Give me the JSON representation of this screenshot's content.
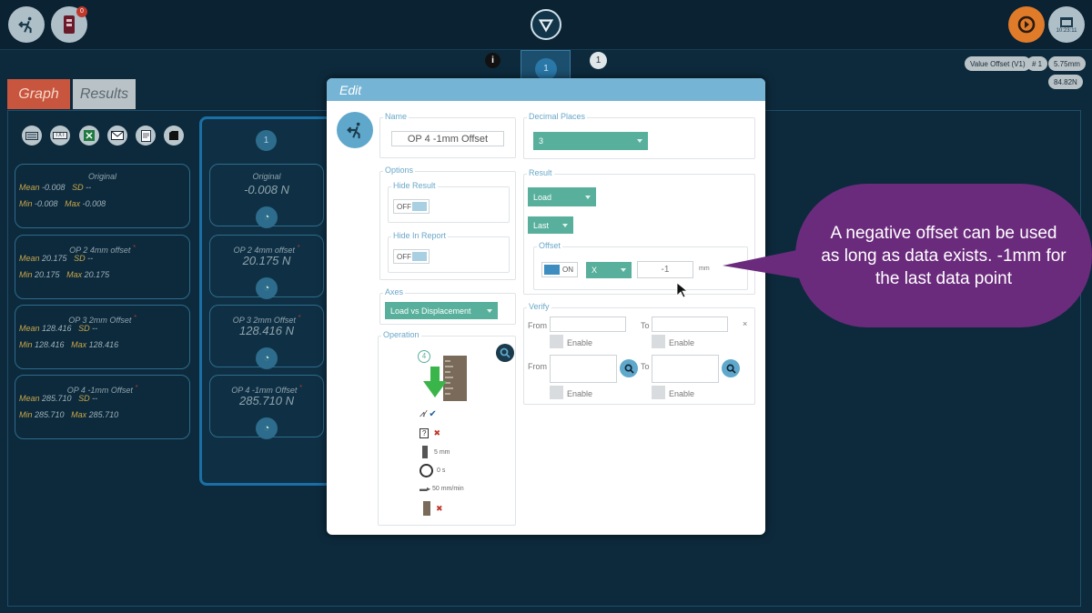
{
  "header": {
    "notification_count": "0",
    "clock_time": "10:23:11"
  },
  "status_pills": {
    "value_offset": "Value Offset (V1)",
    "index": "# 1",
    "displacement": "5.75mm",
    "force": "84.82N"
  },
  "top_stage": {
    "left_badge": "i",
    "center_number": "1",
    "right_number": "1"
  },
  "tabs": {
    "graph": "Graph",
    "results": "Results"
  },
  "toolbar": {
    "export_txt": "TXT"
  },
  "column_number": "1",
  "summary_cards": [
    {
      "title": "Original",
      "mean": "-0.008",
      "sd": "--",
      "min": "-0.008",
      "max": "-0.008"
    },
    {
      "title": "OP 2 4mm offset",
      "mark": "*",
      "mean": "20.175",
      "sd": "--",
      "min": "20.175",
      "max": "20.175"
    },
    {
      "title": "OP 3 2mm Offset",
      "mark": "*",
      "mean": "128.416",
      "sd": "--",
      "min": "128.416",
      "max": "128.416"
    },
    {
      "title": "OP 4 -1mm Offset",
      "mark": "*",
      "mean": "285.710",
      "sd": "--",
      "min": "285.710",
      "max": "285.710"
    }
  ],
  "summary_labels": {
    "mean": "Mean",
    "sd": "SD",
    "min": "Min",
    "max": "Max"
  },
  "value_cards": [
    {
      "title": "Original",
      "value": "-0.008 N"
    },
    {
      "title": "OP 2 4mm offset",
      "mark": "*",
      "value": "20.175 N"
    },
    {
      "title": "OP 3 2mm Offset",
      "mark": "*",
      "value": "128.416 N"
    },
    {
      "title": "OP 4 -1mm Offset",
      "mark": "*",
      "value": "285.710 N"
    }
  ],
  "modal": {
    "title": "Edit",
    "name_legend": "Name",
    "name_value": "OP 4 -1mm Offset",
    "decimal_legend": "Decimal Places",
    "decimal_value": "3",
    "options_legend": "Options",
    "hide_result_legend": "Hide Result",
    "hide_result_state": "OFF",
    "hide_report_legend": "Hide In Report",
    "hide_report_state": "OFF",
    "axes_legend": "Axes",
    "axes_value": "Load vs Displacement",
    "operation_legend": "Operation",
    "op_step": "4",
    "op_rows": [
      {
        "icon": "signal-icon",
        "value": ""
      },
      {
        "icon": "question-icon",
        "value": ""
      },
      {
        "icon": "distance-icon",
        "value": "5 mm"
      },
      {
        "icon": "timer-icon",
        "value": "0 s"
      },
      {
        "icon": "speed-icon",
        "value": "50 mm/min"
      },
      {
        "icon": "specimen-icon",
        "value": ""
      }
    ],
    "result_legend": "Result",
    "result_type": "Load",
    "result_position": "Last",
    "offset_legend": "Offset",
    "offset_state": "ON",
    "offset_axis": "X",
    "offset_value": "-1",
    "offset_unit": "mm",
    "verify_legend": "Verify",
    "from_label": "From",
    "to_label": "To",
    "enable_label": "Enable"
  },
  "callout": {
    "text": "A negative offset can be used as long as data exists. -1mm for the last data point"
  },
  "colors": {
    "background": "#0d2a3c",
    "accent": "#75b4d4",
    "teal": "#58b09c",
    "orange": "#e07b2a",
    "callout": "#6b2b7d",
    "tab_graph": "#c8553d"
  }
}
